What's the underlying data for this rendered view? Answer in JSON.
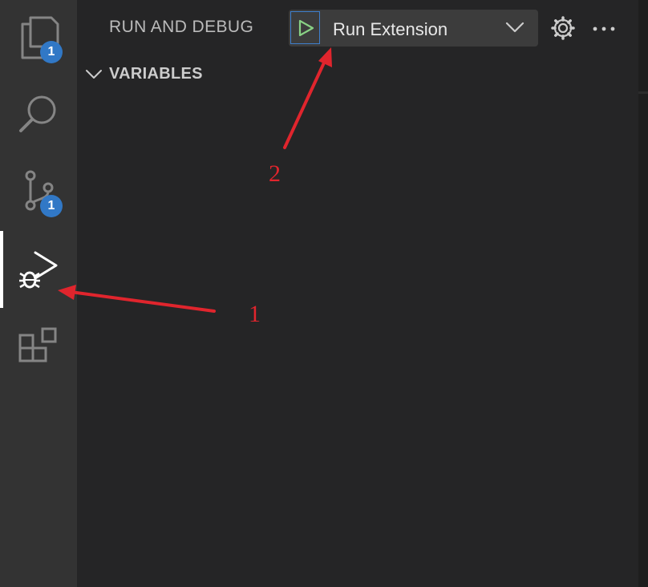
{
  "activity_bar": {
    "items": [
      {
        "name": "Explorer",
        "icon": "files-icon",
        "badge": "1"
      },
      {
        "name": "Search",
        "icon": "search-icon"
      },
      {
        "name": "Source Control",
        "icon": "source-control-icon",
        "badge": "1"
      },
      {
        "name": "Run and Debug",
        "icon": "run-debug-icon",
        "active": true
      },
      {
        "name": "Extensions",
        "icon": "extensions-icon"
      }
    ],
    "badge_color": "#3178c6"
  },
  "sidebar": {
    "title": "RUN AND DEBUG",
    "config_select": {
      "value": "Run Extension"
    },
    "sections": [
      {
        "title": "VARIABLES",
        "expanded": true
      }
    ]
  },
  "annotations": {
    "color": "#e0252d",
    "labels": [
      "1",
      "2"
    ]
  },
  "colors": {
    "activity_bar_bg": "#333333",
    "sidebar_bg": "#252526",
    "run_icon": "#89d185",
    "focus_border": "#3f7fcc"
  }
}
